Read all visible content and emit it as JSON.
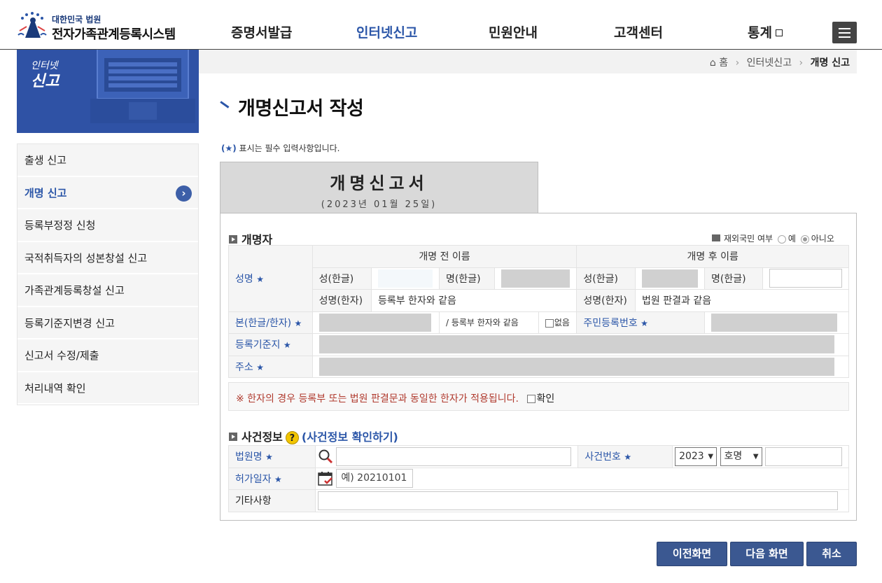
{
  "header": {
    "logo_small": "대한민국 법원",
    "logo_big": "전자가족관계등록시스템",
    "nav": [
      "증명서발급",
      "인터넷신고",
      "민원안내",
      "고객센터",
      "통계"
    ]
  },
  "banner": {
    "line1": "인터넷",
    "line2": "신고"
  },
  "sidebar": {
    "items": [
      {
        "label": "출생 신고"
      },
      {
        "label": "개명 신고"
      },
      {
        "label": "등록부정정 신청"
      },
      {
        "label": "국적취득자의 성본창설 신고"
      },
      {
        "label": "가족관계등록창설 신고"
      },
      {
        "label": "등록기준지변경 신고"
      },
      {
        "label": "신고서 수정/제출"
      },
      {
        "label": "처리내역 확인"
      }
    ],
    "arrow": "›"
  },
  "breadcrumb": {
    "home": "홈",
    "level1": "인터넷신고",
    "current": "개명 신고"
  },
  "page_title": "개명신고서 작성",
  "required_note": {
    "mark": "(★)",
    "text": " 표시는 필수 입력사항입니다."
  },
  "form_header": {
    "title": "개명신고서",
    "date": "(2023년 01월 25일)"
  },
  "section1": {
    "title": "개명자",
    "abroad_label": "재외국민 여부",
    "yes": "예",
    "no": "아니오",
    "before_header": "개명 전 이름",
    "after_header": "개명 후 이름",
    "name_label": "성명",
    "surname_kor": "성(한글)",
    "given_kor": "명(한글)",
    "name_hanja": "성명(한자)",
    "before_hanja_value": "등록부 한자와 같음",
    "after_hanja_value": "법원 판결과 같음",
    "bon_label": "본(한글/한자)",
    "bon_note": "/ 등록부 한자와 같음",
    "none_label": "없음",
    "resident_no_label": "주민등록번호",
    "reg_base_label": "등록기준지",
    "address_label": "주소",
    "star": "★"
  },
  "notice": {
    "text": "※ 한자의 경우 등록부 또는 법원 판결문과 동일한 한자가 적용됩니다.",
    "confirm": "확인"
  },
  "section2": {
    "title": "사건정보",
    "help": "?",
    "link": "(사건정보 확인하기)",
    "court_label": "법원명",
    "case_no_label": "사건번호",
    "year": "2023",
    "case_type": "호명",
    "permit_date_label": "허가일자",
    "date_placeholder": "예) 20210101",
    "etc_label": "기타사항"
  },
  "buttons": {
    "prev": "이전화면",
    "next": "다음 화면",
    "cancel": "취소"
  }
}
